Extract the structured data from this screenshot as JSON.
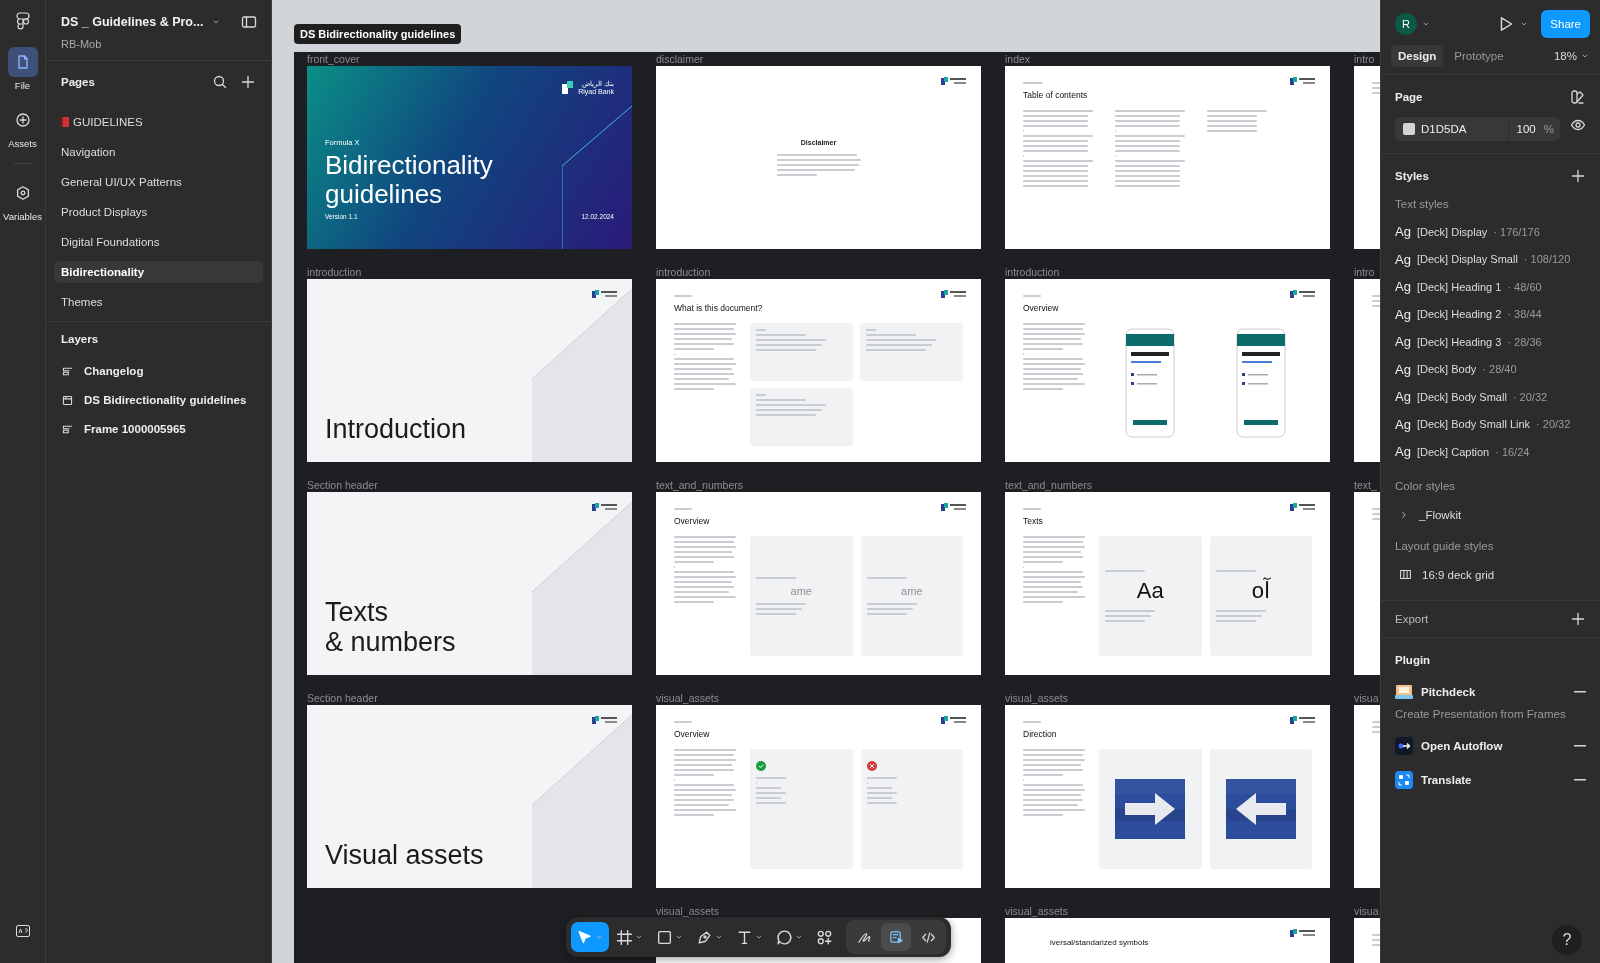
{
  "file": {
    "name": "DS _ Guidelines & Pro...",
    "team": "RB-Mob"
  },
  "rail": [
    {
      "kind": "file",
      "label": "File",
      "selected": true
    },
    {
      "kind": "assets",
      "label": "Assets",
      "selected": false
    },
    {
      "kind": "variables",
      "label": "Variables",
      "selected": false
    }
  ],
  "pages": {
    "title": "Pages",
    "items": [
      {
        "label": "GUIDELINES",
        "book": true,
        "selected": false
      },
      {
        "label": "Navigation",
        "book": false,
        "selected": false
      },
      {
        "label": "General UI/UX Patterns",
        "book": false,
        "selected": false
      },
      {
        "label": "Product Displays",
        "book": false,
        "selected": false
      },
      {
        "label": "Digital Foundations",
        "book": false,
        "selected": false
      },
      {
        "label": "Bidirectionality",
        "book": false,
        "selected": true
      },
      {
        "label": "Themes",
        "book": false,
        "selected": false
      }
    ]
  },
  "layers": {
    "title": "Layers",
    "items": [
      {
        "kind": "stack",
        "label": "Changelog"
      },
      {
        "kind": "frame",
        "label": "DS Bidirectionality guidelines"
      },
      {
        "kind": "stack",
        "label": "Frame 1000005965"
      }
    ]
  },
  "canvas": {
    "frame_label": "DS Bidirectionality guidelines",
    "rows": [
      [
        {
          "label": "front_cover",
          "kind": "cover",
          "logo": [
            "بنك الرياض",
            "Riyad Bank"
          ],
          "eyebrow": "Formula X",
          "title": "Bidirectionality\nguidelines",
          "version": "Version 1.1",
          "date": "12.02.2024"
        },
        {
          "label": "disclaimer",
          "kind": "disclaimer",
          "title": "Disclaimer"
        },
        {
          "label": "index",
          "kind": "toc",
          "title": "Table of contents"
        },
        {
          "label": "intro",
          "kind": "blank"
        }
      ],
      [
        {
          "label": "introduction",
          "kind": "section",
          "title": "Introduction"
        },
        {
          "label": "introduction",
          "kind": "content",
          "title": "What is this document?",
          "panel": {
            "kind": "cards"
          }
        },
        {
          "label": "introduction",
          "kind": "content",
          "title": "Overview",
          "panel": {
            "kind": "phones"
          }
        },
        {
          "label": "intro",
          "kind": "blank"
        }
      ],
      [
        {
          "label": "Section header",
          "kind": "section",
          "title": "Texts\n& numbers"
        },
        {
          "label": "text_and_numbers",
          "kind": "content",
          "title": "Overview",
          "panel": {
            "kind": "glyphs"
          },
          "glyphs": [
            "ame",
            "ame"
          ]
        },
        {
          "label": "text_and_numbers",
          "kind": "content",
          "title": "Texts",
          "panel": {
            "kind": "glyphs"
          },
          "glyphs": [
            "Aa",
            "oآ"
          ]
        },
        {
          "label": "text_",
          "kind": "blank"
        }
      ],
      [
        {
          "label": "Section header",
          "kind": "section",
          "title": "Visual assets"
        },
        {
          "label": "visual_assets",
          "kind": "content",
          "title": "Overview",
          "panel": {
            "kind": "status"
          }
        },
        {
          "label": "visual_assets",
          "kind": "content",
          "title": "Direction",
          "panel": {
            "kind": "arrows"
          }
        },
        {
          "label": "visua",
          "kind": "blank"
        }
      ],
      [
        {
          "kind": "none"
        },
        {
          "label": "visual_assets",
          "kind": "plain"
        },
        {
          "label": "visual_assets",
          "kind": "partial",
          "title": "iversal/standarized symbols"
        },
        {
          "label": "visua",
          "kind": "blank"
        }
      ]
    ]
  },
  "toolbar": {
    "tools": [
      {
        "kind": "move",
        "selected": true
      },
      {
        "kind": "frame",
        "selected": false
      },
      {
        "kind": "rect",
        "selected": false
      },
      {
        "kind": "pen",
        "selected": false
      },
      {
        "kind": "text",
        "selected": false
      },
      {
        "kind": "comment",
        "selected": false
      },
      {
        "kind": "actions",
        "selected": false
      }
    ],
    "modes": [
      {
        "kind": "draw",
        "selected": false
      },
      {
        "kind": "dev",
        "selected": true
      },
      {
        "kind": "code",
        "selected": false
      }
    ]
  },
  "right": {
    "avatar": "R",
    "share": "Share",
    "tabs": [
      {
        "label": "Design",
        "selected": true
      },
      {
        "label": "Prototype",
        "selected": false
      }
    ],
    "zoom": "18%",
    "page": {
      "title": "Page",
      "color": "D1D5DA",
      "opacity": "100",
      "unit": "%"
    },
    "styles": {
      "title": "Styles",
      "text_title": "Text styles",
      "text_styles": [
        {
          "sample": "Ag",
          "name": "[Deck] Display",
          "spec": "· 176/176"
        },
        {
          "sample": "Ag",
          "name": "[Deck] Display Small",
          "spec": "· 108/120"
        },
        {
          "sample": "Ag",
          "name": "[Deck] Heading 1",
          "spec": "· 48/60"
        },
        {
          "sample": "Ag",
          "name": "[Deck] Heading 2",
          "spec": "· 38/44"
        },
        {
          "sample": "Ag",
          "name": "[Deck] Heading 3",
          "spec": "· 28/36"
        },
        {
          "sample": "Ag",
          "name": "[Deck] Body",
          "spec": "· 28/40"
        },
        {
          "sample": "Ag",
          "name": "[Deck] Body Small",
          "spec": "· 20/32"
        },
        {
          "sample": "Ag",
          "name": "[Deck] Body Small Link",
          "spec": "· 20/32"
        },
        {
          "sample": "Ag",
          "name": "[Deck] Caption",
          "spec": "· 16/24"
        }
      ],
      "color_title": "Color styles",
      "color_styles": [
        "_Flowkit"
      ],
      "layout_title": "Layout guide styles",
      "layout_styles": [
        "16:9 deck grid"
      ]
    },
    "export": "Export",
    "plugin": {
      "title": "Plugin",
      "items": [
        {
          "kind": "pitchdeck",
          "name": "Pitchdeck",
          "description": "Create Presentation from Frames"
        },
        {
          "kind": "autoflow",
          "name": "Open Autoflow"
        },
        {
          "kind": "translate",
          "name": "Translate"
        }
      ]
    },
    "help": "?"
  }
}
